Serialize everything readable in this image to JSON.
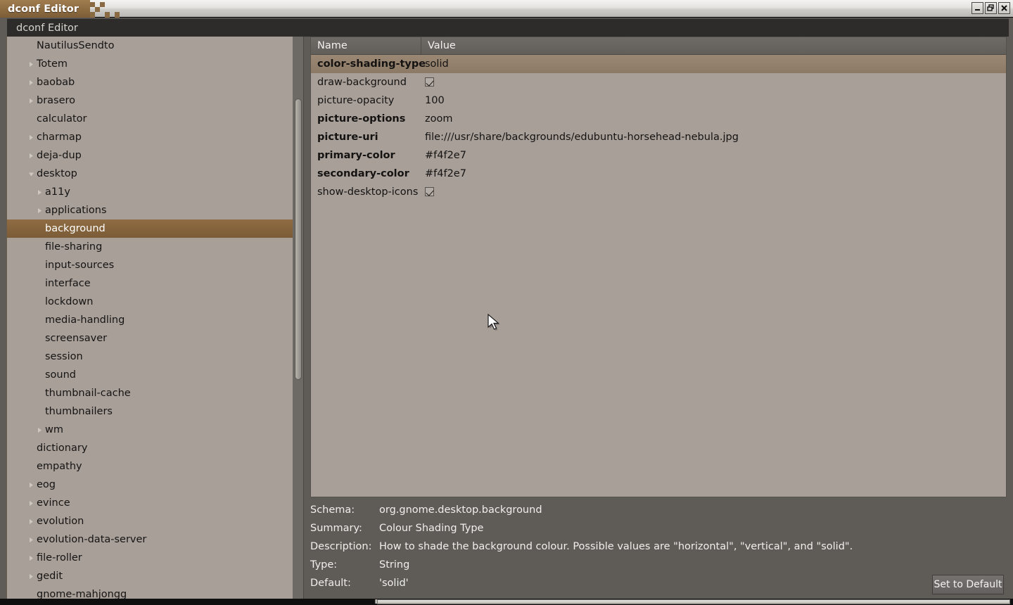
{
  "window": {
    "title": "dconf Editor",
    "controls": [
      {
        "name": "minimize-button",
        "glyph": "minimize"
      },
      {
        "name": "restore-button",
        "glyph": "restore"
      },
      {
        "name": "close-button",
        "glyph": "close"
      }
    ]
  },
  "app_header": {
    "title": "dconf Editor"
  },
  "colors": {
    "selection_brown": "#8f6c42",
    "row_selection": "#9a8874",
    "pane_bg": "#a89f99",
    "header_dark": "#2e2c2a",
    "detail_bg": "#5f5b57"
  },
  "tree": {
    "items": [
      {
        "label": "NautilusSendto",
        "depth": 1,
        "expander": "none",
        "selected": false
      },
      {
        "label": "Totem",
        "depth": 1,
        "expander": "collapsed",
        "selected": false
      },
      {
        "label": "baobab",
        "depth": 1,
        "expander": "collapsed",
        "selected": false
      },
      {
        "label": "brasero",
        "depth": 1,
        "expander": "collapsed",
        "selected": false
      },
      {
        "label": "calculator",
        "depth": 1,
        "expander": "none",
        "selected": false
      },
      {
        "label": "charmap",
        "depth": 1,
        "expander": "collapsed",
        "selected": false
      },
      {
        "label": "deja-dup",
        "depth": 1,
        "expander": "collapsed",
        "selected": false
      },
      {
        "label": "desktop",
        "depth": 1,
        "expander": "expanded",
        "selected": false
      },
      {
        "label": "a11y",
        "depth": 2,
        "expander": "collapsed",
        "selected": false
      },
      {
        "label": "applications",
        "depth": 2,
        "expander": "collapsed",
        "selected": false
      },
      {
        "label": "background",
        "depth": 2,
        "expander": "none",
        "selected": true
      },
      {
        "label": "file-sharing",
        "depth": 2,
        "expander": "none",
        "selected": false
      },
      {
        "label": "input-sources",
        "depth": 2,
        "expander": "none",
        "selected": false
      },
      {
        "label": "interface",
        "depth": 2,
        "expander": "none",
        "selected": false
      },
      {
        "label": "lockdown",
        "depth": 2,
        "expander": "none",
        "selected": false
      },
      {
        "label": "media-handling",
        "depth": 2,
        "expander": "none",
        "selected": false
      },
      {
        "label": "screensaver",
        "depth": 2,
        "expander": "none",
        "selected": false
      },
      {
        "label": "session",
        "depth": 2,
        "expander": "none",
        "selected": false
      },
      {
        "label": "sound",
        "depth": 2,
        "expander": "none",
        "selected": false
      },
      {
        "label": "thumbnail-cache",
        "depth": 2,
        "expander": "none",
        "selected": false
      },
      {
        "label": "thumbnailers",
        "depth": 2,
        "expander": "none",
        "selected": false
      },
      {
        "label": "wm",
        "depth": 2,
        "expander": "collapsed",
        "selected": false
      },
      {
        "label": "dictionary",
        "depth": 1,
        "expander": "none",
        "selected": false
      },
      {
        "label": "empathy",
        "depth": 1,
        "expander": "none",
        "selected": false
      },
      {
        "label": "eog",
        "depth": 1,
        "expander": "collapsed",
        "selected": false
      },
      {
        "label": "evince",
        "depth": 1,
        "expander": "collapsed",
        "selected": false
      },
      {
        "label": "evolution",
        "depth": 1,
        "expander": "collapsed",
        "selected": false
      },
      {
        "label": "evolution-data-server",
        "depth": 1,
        "expander": "collapsed",
        "selected": false
      },
      {
        "label": "file-roller",
        "depth": 1,
        "expander": "collapsed",
        "selected": false
      },
      {
        "label": "gedit",
        "depth": 1,
        "expander": "collapsed",
        "selected": false
      },
      {
        "label": "gnome-mahjongg",
        "depth": 1,
        "expander": "none",
        "selected": false
      }
    ]
  },
  "list": {
    "columns": [
      {
        "label": "Name"
      },
      {
        "label": "Value"
      }
    ],
    "rows": [
      {
        "name": "color-shading-type",
        "value": "solid",
        "type": "text",
        "bold": true,
        "selected": true
      },
      {
        "name": "draw-background",
        "value": "",
        "type": "checkbox",
        "checked": true,
        "bold": false,
        "selected": false
      },
      {
        "name": "picture-opacity",
        "value": "100",
        "type": "text",
        "bold": false,
        "selected": false
      },
      {
        "name": "picture-options",
        "value": "zoom",
        "type": "text",
        "bold": true,
        "selected": false
      },
      {
        "name": "picture-uri",
        "value": "file:///usr/share/backgrounds/edubuntu-horsehead-nebula.jpg",
        "type": "text",
        "bold": true,
        "selected": false
      },
      {
        "name": "primary-color",
        "value": "#f4f2e7",
        "type": "text",
        "bold": true,
        "selected": false
      },
      {
        "name": "secondary-color",
        "value": "#f4f2e7",
        "type": "text",
        "bold": true,
        "selected": false
      },
      {
        "name": "show-desktop-icons",
        "value": "",
        "type": "checkbox",
        "checked": true,
        "bold": false,
        "selected": false
      }
    ]
  },
  "detail": {
    "fields": [
      {
        "key": "Schema:",
        "value": "org.gnome.desktop.background"
      },
      {
        "key": "Summary:",
        "value": "Colour Shading Type"
      },
      {
        "key": "Description:",
        "value": "How to shade the background colour. Possible values are \"horizontal\", \"vertical\", and \"solid\"."
      },
      {
        "key": "Type:",
        "value": "String"
      },
      {
        "key": "Default:",
        "value": "'solid'"
      }
    ],
    "set_default_label": "Set to Default"
  }
}
